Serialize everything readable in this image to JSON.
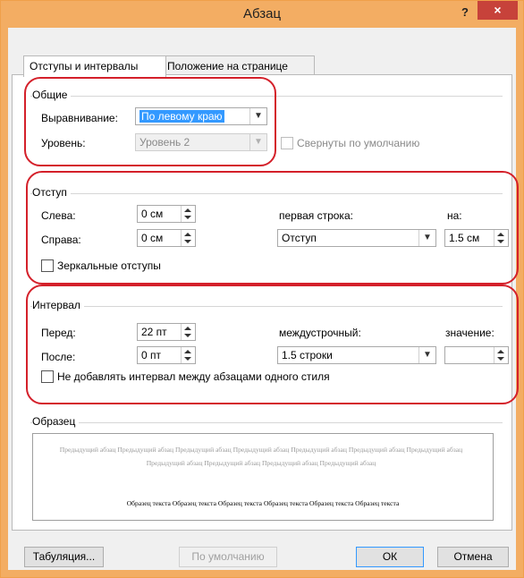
{
  "window": {
    "title": "Абзац",
    "help_label": "?",
    "close_label": "×"
  },
  "tabs": [
    {
      "label": "Отступы и интервалы",
      "active": true
    },
    {
      "label": "Положение на странице",
      "active": false
    }
  ],
  "general": {
    "title": "Общие",
    "alignment": {
      "label": "Выравнивание:",
      "value": "По левому краю"
    },
    "level": {
      "label": "Уровень:",
      "value": "Уровень 2"
    },
    "collapsed": {
      "label": "Свернуты по умолчанию",
      "checked": false,
      "disabled": true
    }
  },
  "indent": {
    "title": "Отступ",
    "left": {
      "label": "Слева:",
      "value": "0 см"
    },
    "right": {
      "label": "Справа:",
      "value": "0 см"
    },
    "first_line": {
      "label": "первая строка:",
      "value": "Отступ"
    },
    "by": {
      "label": "на:",
      "value": "1.5 см"
    },
    "mirror": {
      "label": "Зеркальные отступы",
      "checked": false
    }
  },
  "spacing": {
    "title": "Интервал",
    "before": {
      "label": "Перед:",
      "value": "22 пт"
    },
    "after": {
      "label": "После:",
      "value": "0 пт"
    },
    "line_spacing": {
      "label": "междустрочный:",
      "value": "1.5 строки"
    },
    "at": {
      "label": "значение:",
      "value": ""
    },
    "no_space_same_style": {
      "label": "Не добавлять интервал между абзацами одного стиля",
      "checked": false
    }
  },
  "preview": {
    "title": "Образец",
    "previous_text": "Предыдущий абзац Предыдущий абзац Предыдущий абзац Предыдущий абзац Предыдущий абзац Предыдущий абзац Предыдущий абзац Предыдущий абзац Предыдущий абзац Предыдущий абзац Предыдущий абзац",
    "sample_text": "Образец текста Образец текста Образец текста Образец текста Образец текста Образец текста"
  },
  "buttons": {
    "tabs": "Табуляция...",
    "default": "По умолчанию",
    "ok": "ОК",
    "cancel": "Отмена"
  },
  "colors": {
    "window_border": "#f3ad63",
    "close_button": "#c7423a",
    "highlight": "#d4202a",
    "selection": "#3399ff"
  }
}
